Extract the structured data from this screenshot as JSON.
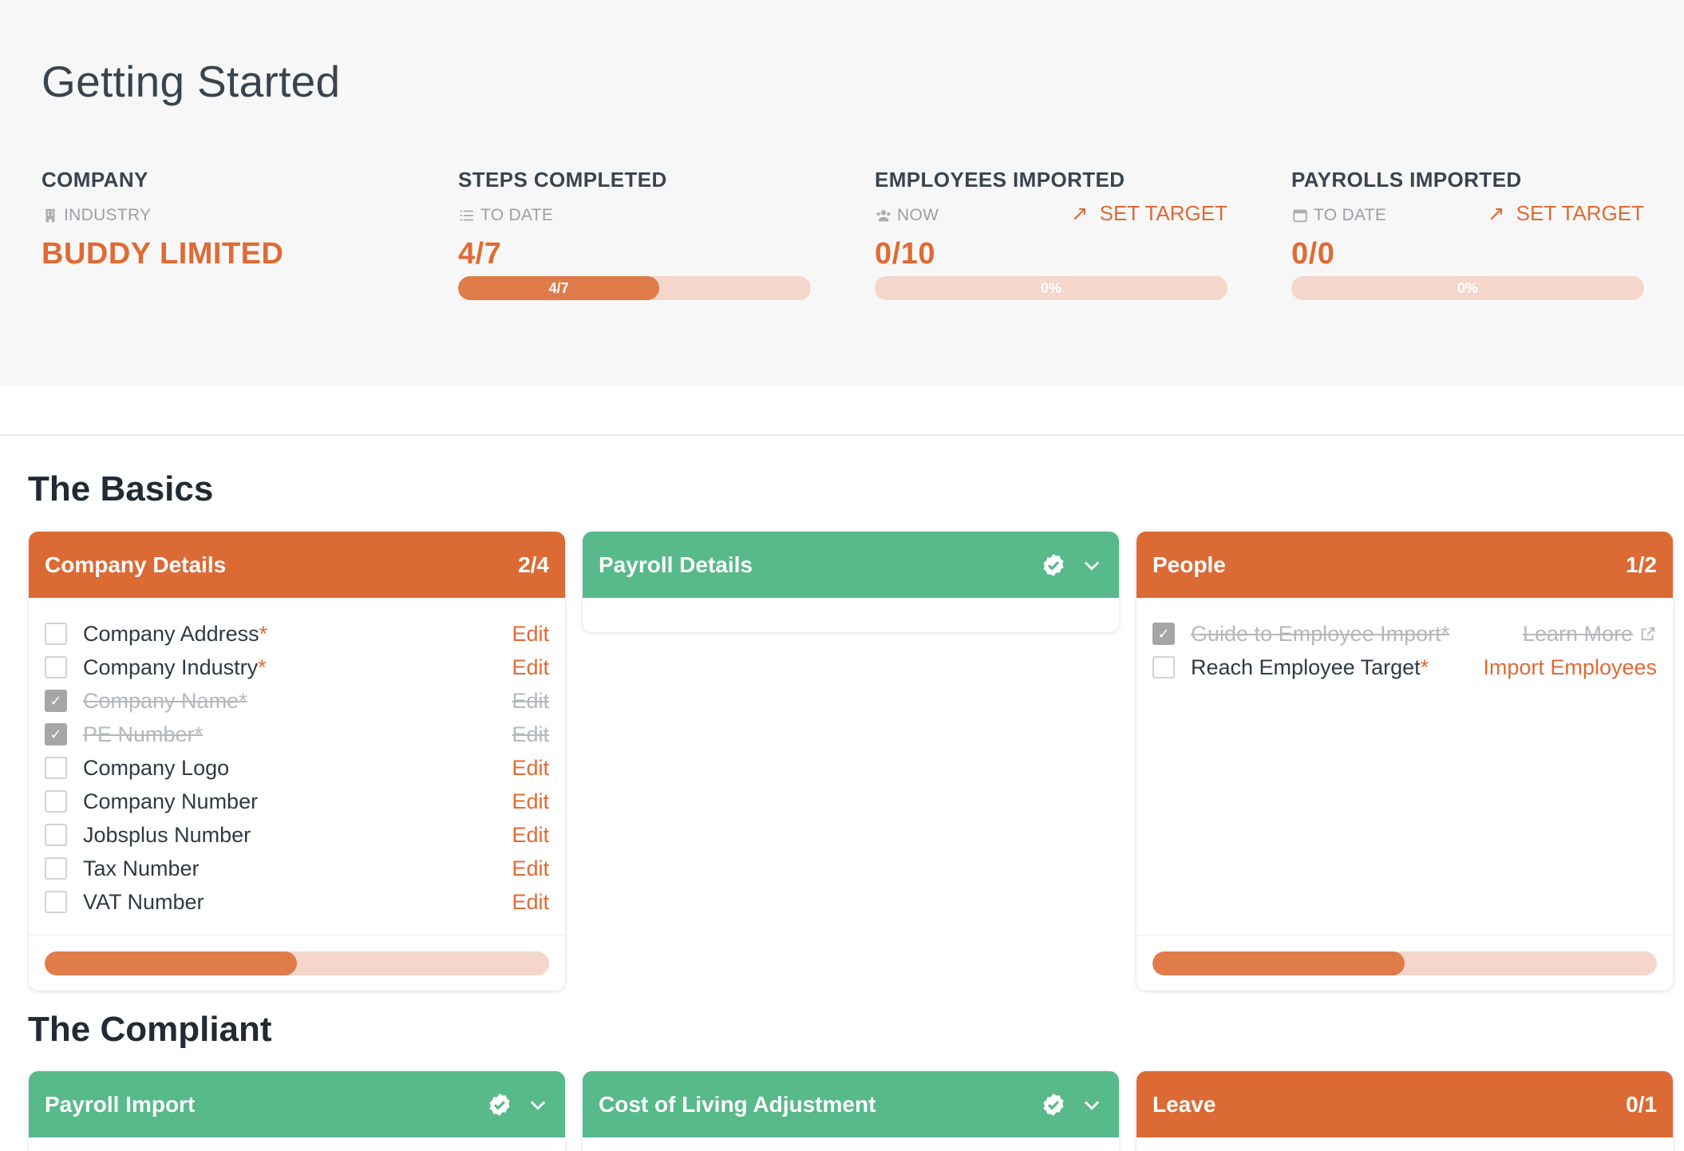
{
  "page": {
    "title": "Getting Started"
  },
  "colors": {
    "accent": "#e06a34",
    "success": "#58b98b",
    "track": "#f4d6ca"
  },
  "stats": {
    "company": {
      "label": "COMPANY",
      "sub": "INDUSTRY",
      "sub_icon": "building-icon",
      "value": "BUDDY LIMITED"
    },
    "steps": {
      "label": "STEPS COMPLETED",
      "sub": "TO DATE",
      "sub_icon": "list-icon",
      "value": "4/7",
      "progress": 0.571,
      "bar_text": "4/7"
    },
    "employees": {
      "label": "EMPLOYEES IMPORTED",
      "sub": "NOW",
      "sub_icon": "users-icon",
      "value": "0/10",
      "progress": 0,
      "bar_text": "0%",
      "action": "SET TARGET"
    },
    "payrolls": {
      "label": "PAYROLLS IMPORTED",
      "sub": "TO DATE",
      "sub_icon": "calendar-icon",
      "value": "0/0",
      "progress": 0,
      "bar_text": "0%",
      "action": "SET TARGET"
    }
  },
  "sections": {
    "basics": {
      "title": "The Basics"
    },
    "compliant": {
      "title": "The Compliant"
    }
  },
  "cards": {
    "company_details": {
      "title": "Company Details",
      "count": "2/4",
      "progress": 0.5,
      "items": [
        {
          "label": "Company Address",
          "required": "*",
          "action": "Edit"
        },
        {
          "label": "Company Industry",
          "required": "*",
          "action": "Edit"
        },
        {
          "label": "Company Name",
          "required": "*",
          "action": "Edit"
        },
        {
          "label": "PE Number",
          "required": "*",
          "action": "Edit"
        },
        {
          "label": "Company Logo",
          "required": "",
          "action": "Edit"
        },
        {
          "label": "Company Number",
          "required": "",
          "action": "Edit"
        },
        {
          "label": "Jobsplus Number",
          "required": "",
          "action": "Edit"
        },
        {
          "label": "Tax Number",
          "required": "",
          "action": "Edit"
        },
        {
          "label": "VAT Number",
          "required": "",
          "action": "Edit"
        }
      ]
    },
    "payroll_details": {
      "title": "Payroll Details"
    },
    "people": {
      "title": "People",
      "count": "1/2",
      "progress": 0.5,
      "items": [
        {
          "label": "Guide to Employee Import",
          "required": "*",
          "action": "Learn More"
        },
        {
          "label": "Reach Employee Target",
          "required": "*",
          "action": "Import Employees"
        }
      ]
    },
    "payroll_import": {
      "title": "Payroll Import"
    },
    "cola": {
      "title": "Cost of Living Adjustment"
    },
    "leave": {
      "title": "Leave",
      "count": "0/1"
    }
  }
}
